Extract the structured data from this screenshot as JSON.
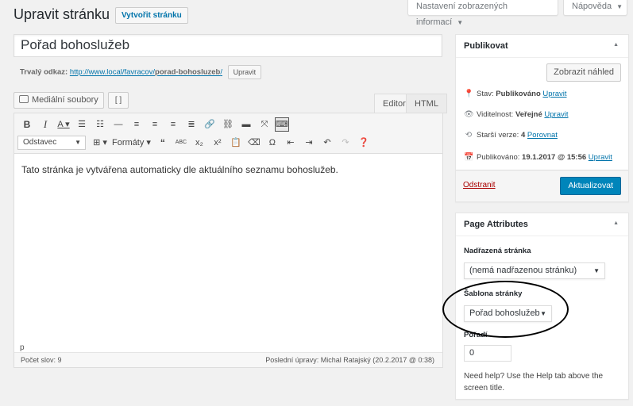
{
  "header": {
    "screen_options": "Nastavení zobrazených informací",
    "help": "Nápověda",
    "page_title": "Upravit stránku",
    "add_new": "Vytvořit stránku"
  },
  "post": {
    "title": "Pořad bohoslužeb",
    "permalink_label": "Trvalý odkaz:",
    "permalink_base": "http://www.local/favracov/",
    "permalink_slug": "porad-bohosluzeb",
    "permalink_end": "/",
    "permalink_edit": "Upravit"
  },
  "editor": {
    "media_button": "Mediální soubory",
    "shortcode_button": "[ ]",
    "tab_visual": "Editor",
    "tab_html": "HTML",
    "format_select": "Odstavec",
    "formats_label": "Formáty",
    "content": "Tato stránka je vytvářena automaticky dle aktuálního seznamu bohoslužeb.",
    "path": "p",
    "word_count": "Počet slov: 9",
    "last_edit": "Poslední úpravy: Michal Ratajský (20.2.2017 @ 0:38)"
  },
  "publish": {
    "title": "Publikovat",
    "preview": "Zobrazit náhled",
    "status_label": "Stav:",
    "status_value": "Publikováno",
    "visibility_label": "Viditelnost:",
    "visibility_value": "Veřejné",
    "revisions_label": "Starší verze:",
    "revisions_value": "4",
    "revisions_link": "Porovnat",
    "published_label": "Publikováno:",
    "published_value": "19.1.2017 @ 15:56",
    "edit_link": "Upravit",
    "delete": "Odstranit",
    "update": "Aktualizovat"
  },
  "attributes": {
    "title": "Page Attributes",
    "parent_label": "Nadřazená stránka",
    "parent_value": "(nemá nadřazenou stránku)",
    "template_label": "Šablona stránky",
    "template_value": "Pořad bohoslužeb",
    "order_label": "Pořadí",
    "order_value": "0",
    "help": "Need help? Use the Help tab above the screen title."
  },
  "colors": {
    "accent": "#0073aa",
    "primary_button": "#0085ba",
    "delete": "#a00000",
    "annotation": "#000000"
  }
}
